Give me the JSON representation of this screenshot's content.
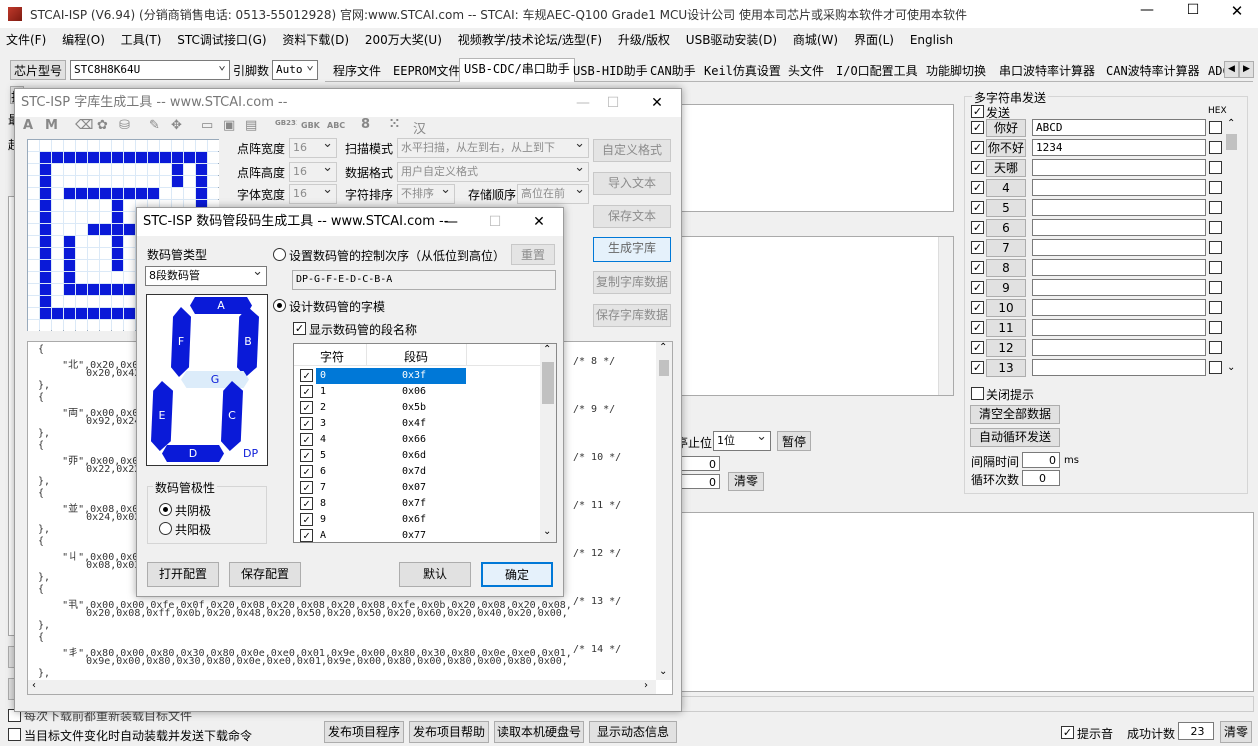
{
  "app": {
    "title": "STCAI-ISP (V6.94) (分销商销售电话: 0513-55012928) 官网:www.STCAI.com  -- STCAI: 车规AEC-Q100 Grade1 MCU设计公司 使用本司芯片或采购本软件才可使用本软件"
  },
  "menu": [
    "文件(F)",
    "编程(O)",
    "工具(T)",
    "STC调试接口(G)",
    "资料下载(D)",
    "200万大奖(U)",
    "视频教学/技术论坛/选型(F)",
    "升级/版权",
    "USB驱动安装(D)",
    "商城(W)",
    "界面(L)",
    "English"
  ],
  "chip": {
    "label": "芯片型号",
    "value": "STC8H8K64U",
    "pin_label": "引脚数",
    "pin_value": "Auto"
  },
  "tabs": [
    "程序文件",
    "EEPROM文件",
    "USB-CDC/串口助手",
    "USB-HID助手",
    "CAN助手",
    "Keil仿真设置",
    "头文件",
    "I/O口配置工具",
    "功能脚切换",
    "串口波特率计算器",
    "CAN波特率计算器",
    "ADC"
  ],
  "multi_send": {
    "title": "多字符串发送",
    "send_label": "发送",
    "hex_label": "HEX",
    "rows": [
      {
        "btn": "你好",
        "value": "ABCD"
      },
      {
        "btn": "你不好",
        "value": "1234"
      },
      {
        "btn": "天哪",
        "value": ""
      },
      {
        "btn": "4",
        "value": ""
      },
      {
        "btn": "5",
        "value": ""
      },
      {
        "btn": "6",
        "value": ""
      },
      {
        "btn": "7",
        "value": ""
      },
      {
        "btn": "8",
        "value": ""
      },
      {
        "btn": "9",
        "value": ""
      },
      {
        "btn": "10",
        "value": ""
      },
      {
        "btn": "11",
        "value": ""
      },
      {
        "btn": "12",
        "value": ""
      },
      {
        "btn": "13",
        "value": ""
      }
    ],
    "close_prompt": "关闭提示",
    "clear_all": "清空全部数据",
    "auto_loop": "自动循环发送",
    "interval_label": "间隔时间",
    "interval_value": "0",
    "interval_unit": "ms",
    "loop_label": "循环次数",
    "loop_value": "0"
  },
  "serial": {
    "stop_label": "亭止位",
    "stop_value": "1位",
    "pause": "暂停",
    "count1": "0",
    "count2": "0",
    "clear": "清零"
  },
  "bottom": {
    "check1": "每次下载前都重新装载目标文件",
    "check2": "当目标文件变化时自动装载并发送下载命令",
    "btn_publish": "发布项目程序",
    "btn_help": "发布项目帮助",
    "btn_disk": "读取本机硬盘号",
    "btn_info": "显示动态信息",
    "sound": "提示音",
    "success_label": "成功计数",
    "success_value": "23",
    "clear": "清零"
  },
  "left_panel": {
    "label1": "起",
    "label2": "最",
    "btn": "扫"
  },
  "font_tool": {
    "title": "STC-ISP 字库生成工具 -- www.STCAI.com --",
    "toolbar_text": [
      "GB2312",
      "GBK",
      "ABC",
      "汉"
    ],
    "rows": [
      {
        "label": "点阵宽度",
        "value": "16",
        "label2": "扫描模式",
        "value2": "水平扫描，从左到右，从上到下"
      },
      {
        "label": "点阵高度",
        "value": "16",
        "label2": "数据格式",
        "value2": "用户自定义格式"
      },
      {
        "label": "字体宽度",
        "value": "16",
        "label2": "字符排序",
        "value2": "不排序",
        "label3": "存储顺序",
        "value3": "高位在前"
      }
    ],
    "side_buttons": [
      "自定义格式",
      "导入文本",
      "保存文本",
      "生成字库",
      "复制字库数据",
      "保存字库数据"
    ],
    "code_lines": [
      "{",
      "    \"北\",0x20,0x02,",
      "        0x20,0x42,",
      "},",
      "{",
      "    \"両\",0x00,0x00,",
      "        0x92,0x24,",
      "},",
      "{",
      "    \"丣\",0x00,0x00,",
      "        0x22,0x22,",
      "},",
      "{",
      "    \"並\",0x08,0x08,",
      "        0x24,0x02,",
      "},",
      "{",
      "    \"丩\",0x00,0x02,",
      "        0x08,0x03,",
      "},",
      "{",
      "    \"丮\",0x00,0x00,0xfe,0x0f,0x20,0x08,0x20,0x08,0x20,0x08,0xfe,0x0b,0x20,0x08,0x20,0x08,",
      "        0x20,0x08,0xff,0x0b,0x20,0x48,0x20,0x50,0x20,0x50,0x20,0x60,0x20,0x40,0x20,0x00,",
      "},",
      "{",
      "    \"丯\",0x80,0x00,0x80,0x30,0x80,0x0e,0xe0,0x01,0x9e,0x00,0x80,0x30,0x80,0x0e,0xe0,0x01,",
      "        0x9e,0x00,0x80,0x30,0x80,0x0e,0xe0,0x01,0x9e,0x00,0x80,0x00,0x80,0x00,0x80,0x00,",
      "},"
    ],
    "comments": [
      "/* 8 */",
      "/* 9 */",
      "/* 10 */",
      "/* 11 */",
      "/* 12 */",
      "/* 13 */",
      "/* 14 */"
    ]
  },
  "seg_tool": {
    "title": "STC-ISP 数码管段码生成工具 -- www.STCAI.com --",
    "type_label": "数码管类型",
    "type_value": "8段数码管",
    "seg_names": [
      "A",
      "B",
      "C",
      "D",
      "E",
      "F",
      "G",
      "DP"
    ],
    "order_radio": "设置数码管的控制次序（从低位到高位）",
    "reset_btn": "重置",
    "order_value": "DP-G-F-E-D-C-B-A",
    "design_radio": "设计数码管的字模",
    "show_names": "显示数码管的段名称",
    "col_char": "字符",
    "col_code": "段码",
    "table": [
      {
        "ch": "0",
        "code": "0x3f"
      },
      {
        "ch": "1",
        "code": "0x06"
      },
      {
        "ch": "2",
        "code": "0x5b"
      },
      {
        "ch": "3",
        "code": "0x4f"
      },
      {
        "ch": "4",
        "code": "0x66"
      },
      {
        "ch": "5",
        "code": "0x6d"
      },
      {
        "ch": "6",
        "code": "0x7d"
      },
      {
        "ch": "7",
        "code": "0x07"
      },
      {
        "ch": "8",
        "code": "0x7f"
      },
      {
        "ch": "9",
        "code": "0x6f"
      },
      {
        "ch": "A",
        "code": "0x77"
      }
    ],
    "polarity_label": "数码管极性",
    "cathode": "共阴极",
    "anode": "共阳极",
    "open_cfg": "打开配置",
    "save_cfg": "保存配置",
    "default": "默认",
    "ok": "确定"
  }
}
